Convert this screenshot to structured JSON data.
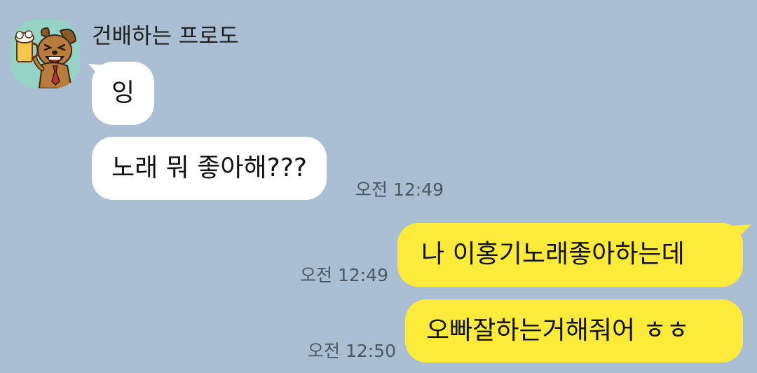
{
  "chat": {
    "sender_name": "건배하는 프로도",
    "avatar_icon": "frodo-cheers-beer-icon",
    "colors": {
      "background": "#aabfd3",
      "incoming_bubble": "#ffffff",
      "outgoing_bubble": "#fceb3a",
      "avatar_background": "#95d3c6"
    },
    "messages": [
      {
        "direction": "incoming",
        "text": "잉",
        "time": ""
      },
      {
        "direction": "incoming",
        "text": "노래 뭐 좋아해???",
        "time": "오전 12:49"
      },
      {
        "direction": "outgoing",
        "text": "나 이홍기노래좋아하는데",
        "time": "오전 12:49"
      },
      {
        "direction": "outgoing",
        "text": "오빠잘하는거해줘어 ㅎㅎ",
        "time": "오전 12:50"
      }
    ]
  }
}
